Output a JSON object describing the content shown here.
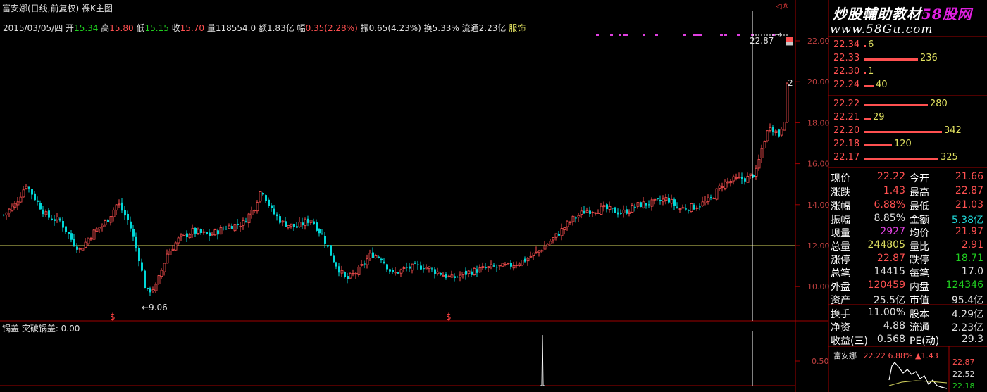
{
  "title": "富安娜(日线,前复权) 裸K主图",
  "info": {
    "date": "2015/03/05/四",
    "open_label": "开",
    "open": "15.34",
    "high_label": "高",
    "high": "15.80",
    "low_label": "低",
    "low": "15.15",
    "close_label": "收",
    "close": "15.70",
    "vol_label": "量",
    "vol": "118554.0",
    "amt_label": "额",
    "amt": "1.83亿",
    "chg_label": "幅",
    "chg": "0.35(2.28%)",
    "amp_label": "振",
    "amp": "0.65(4.23%)",
    "turn_label": "换",
    "turn": "5.33%",
    "float_label": "流通",
    "float": "2.23亿",
    "industry": "服饰"
  },
  "corner_mark": "◁®",
  "annotations": {
    "low_label": "←9.06",
    "high_label": "22.87",
    "high_arrow": "→",
    "s_marker": "$",
    "right_mark": "2"
  },
  "price_axis": [
    "22.00",
    "20.00",
    "18.00",
    "16.00",
    "14.00",
    "12.00",
    "10.00"
  ],
  "sub_chart": {
    "title": "锅盖 突破锅盖: 0.00",
    "axis_label": "0.50"
  },
  "watermark": {
    "line1_a": "炒股輔助教材",
    "line1_b": "58股网",
    "line2": "www.58Gu.com"
  },
  "order_book": {
    "asks": [
      {
        "price": "22.34",
        "vol": "6",
        "bar": 0.02
      },
      {
        "price": "22.33",
        "vol": "236",
        "bar": 0.69
      },
      {
        "price": "22.30",
        "vol": "1",
        "bar": 0.01
      },
      {
        "price": "22.24",
        "vol": "40",
        "bar": 0.12
      }
    ],
    "bids": [
      {
        "price": "22.22",
        "vol": "280",
        "bar": 0.82
      },
      {
        "price": "22.21",
        "vol": "29",
        "bar": 0.08
      },
      {
        "price": "22.20",
        "vol": "342",
        "bar": 1.0
      },
      {
        "price": "22.18",
        "vol": "120",
        "bar": 0.35
      },
      {
        "price": "22.17",
        "vol": "325",
        "bar": 0.95
      }
    ]
  },
  "quote": [
    {
      "l": "现价",
      "lv": "22.22",
      "lc": "red",
      "r": "今开",
      "rv": "21.66",
      "rc": "red"
    },
    {
      "l": "涨跌",
      "lv": "1.43",
      "lc": "red",
      "r": "最高",
      "rv": "22.87",
      "rc": "red"
    },
    {
      "l": "涨幅",
      "lv": "6.88%",
      "lc": "red",
      "r": "最低",
      "rv": "21.03",
      "rc": "red"
    },
    {
      "l": "振幅",
      "lv": "8.85%",
      "lc": "wht",
      "r": "金额",
      "rv": "5.38亿",
      "rc": "cyan"
    },
    {
      "l": "现量",
      "lv": "2927",
      "lc": "mag",
      "r": "均价",
      "rv": "21.97",
      "rc": "red"
    },
    {
      "l": "总量",
      "lv": "244805",
      "lc": "yel",
      "r": "量比",
      "rv": "2.91",
      "rc": "red"
    },
    {
      "l": "涨停",
      "lv": "22.87",
      "lc": "red",
      "r": "跌停",
      "rv": "18.71",
      "rc": "grn"
    },
    {
      "l": "总笔",
      "lv": "14415",
      "lc": "wht",
      "r": "每笔",
      "rv": "17.0",
      "rc": "wht"
    },
    {
      "l": "外盘",
      "lv": "120459",
      "lc": "red",
      "r": "内盘",
      "rv": "124346",
      "rc": "grn"
    },
    {
      "l": "资产",
      "lv": "25.5亿",
      "lc": "wht",
      "r": "市值",
      "rv": "95.4亿",
      "rc": "wht"
    },
    {
      "l": "换手",
      "lv": "11.00%",
      "lc": "wht",
      "r": "股本",
      "rv": "4.29亿",
      "rc": "wht"
    },
    {
      "l": "净资",
      "lv": "4.88",
      "lc": "wht",
      "r": "流通",
      "rv": "2.23亿",
      "rc": "wht"
    },
    {
      "l": "收益(三)",
      "lv": "0.568",
      "lc": "wht",
      "r": "PE(动)",
      "rv": "29.3",
      "rc": "wht"
    }
  ],
  "mini": {
    "name": "富安娜",
    "price": "22.22",
    "pct": "6.88%",
    "chg": "▲1.43",
    "axis": [
      "22.87",
      "22.52",
      "22.18"
    ]
  },
  "colors": {
    "up": "#ff5050",
    "down": "#00d8d8",
    "grid": "#800000",
    "hline": "#d8d860",
    "magenta": "#e040e0"
  }
}
